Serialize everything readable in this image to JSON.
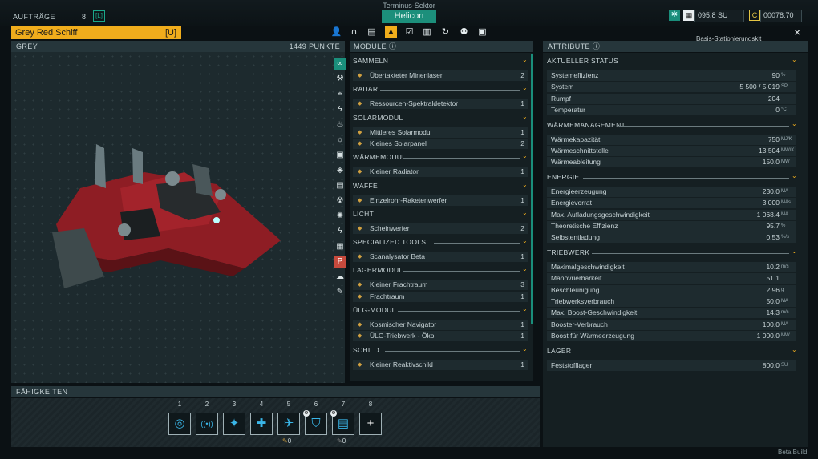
{
  "top": {
    "sector": "Terminus-Sektor",
    "location": "Helicon",
    "auftraege_label": "AUFTRÄGE",
    "auftraege_count": "8",
    "auftraege_key": "[L]",
    "res1": "095.8 SU",
    "res2": "00078.70"
  },
  "ship": {
    "name": "Grey Red Schiff",
    "key": "[U]",
    "faction": "GREY",
    "points": "1449 PUNKTE"
  },
  "tabs": [
    "person-icon",
    "network-icon",
    "storage-icon",
    "ship-icon",
    "checklist-icon",
    "map-icon",
    "history-icon",
    "crew-icon",
    "log-icon"
  ],
  "close": "×",
  "basis_label": "Basis-Stationierungskit",
  "modules": {
    "header": "MODULE",
    "sections": [
      {
        "name": "SAMMELN",
        "items": [
          {
            "n": "Übertakteter Minenlaser",
            "c": "2"
          }
        ]
      },
      {
        "name": "RADAR",
        "items": [
          {
            "n": "Ressourcen-Spektraldetektor",
            "c": "1"
          }
        ]
      },
      {
        "name": "SOLARMODUL",
        "items": [
          {
            "n": "Mittleres Solarmodul",
            "c": "1"
          },
          {
            "n": "Kleines Solarpanel",
            "c": "2"
          }
        ]
      },
      {
        "name": "WÄRMEMODUL",
        "items": [
          {
            "n": "Kleiner Radiator",
            "c": "1"
          }
        ]
      },
      {
        "name": "WAFFE",
        "items": [
          {
            "n": "Einzelrohr-Raketenwerfer",
            "c": "1"
          }
        ]
      },
      {
        "name": "LICHT",
        "items": [
          {
            "n": "Scheinwerfer",
            "c": "2"
          }
        ]
      },
      {
        "name": "SPECIALIZED TOOLS",
        "items": [
          {
            "n": "Scanalysator Beta",
            "c": "1"
          }
        ]
      },
      {
        "name": "LAGERMODUL",
        "items": [
          {
            "n": "Kleiner Frachtraum",
            "c": "3"
          },
          {
            "n": "Frachtraum",
            "c": "1"
          }
        ]
      },
      {
        "name": "ÜLG-MODUL",
        "items": [
          {
            "n": "Kosmischer Navigator",
            "c": "1"
          },
          {
            "n": "ÜLG-Triebwerk - Öko",
            "c": "1"
          }
        ]
      },
      {
        "name": "SCHILD",
        "items": [
          {
            "n": "Kleiner Reaktivschild",
            "c": "1"
          }
        ]
      }
    ]
  },
  "attributes": {
    "header": "ATTRIBUTE",
    "sections": [
      {
        "name": "AKTUELLER STATUS",
        "rows": [
          {
            "n": "Systemeffizienz",
            "v": "90",
            "u": "%"
          },
          {
            "n": "System",
            "v": "5 500 / 5 019",
            "u": "SP"
          },
          {
            "n": "Rumpf",
            "v": "204",
            "u": ""
          },
          {
            "n": "Temperatur",
            "v": "0",
            "u": "°C"
          }
        ]
      },
      {
        "name": "WÄRMEMANAGEMENT",
        "rows": [
          {
            "n": "Wärmekapazität",
            "v": "750",
            "u": "MJ/K"
          },
          {
            "n": "Wärmeschnittstelle",
            "v": "13 504",
            "u": "MW/K"
          },
          {
            "n": "Wärmeableitung",
            "v": "150.0",
            "u": "MW"
          }
        ]
      },
      {
        "name": "ENERGIE",
        "rows": [
          {
            "n": "Energieerzeugung",
            "v": "230.0",
            "u": "MA"
          },
          {
            "n": "Energievorrat",
            "v": "3 000",
            "u": "MAs"
          },
          {
            "n": "Max. Aufladungsgeschwindigkeit",
            "v": "1 068.4",
            "u": "MA"
          },
          {
            "n": "Theoretische Effizienz",
            "v": "95.7",
            "u": "%"
          },
          {
            "n": "Selbstentladung",
            "v": "0.53",
            "u": "%/s"
          }
        ]
      },
      {
        "name": "TRIEBWERK",
        "rows": [
          {
            "n": "Maximalgeschwindigkeit",
            "v": "10.2",
            "u": "m/s"
          },
          {
            "n": "Manövrierbarkeit",
            "v": "51.1",
            "u": ""
          },
          {
            "n": "Beschleunigung",
            "v": "2.96",
            "u": "g"
          },
          {
            "n": "Triebwerksverbrauch",
            "v": "50.0",
            "u": "MA"
          },
          {
            "n": "Max. Boost-Geschwindigkeit",
            "v": "14.3",
            "u": "m/s"
          },
          {
            "n": "Booster-Verbrauch",
            "v": "100.0",
            "u": "MA"
          },
          {
            "n": "Boost für Wärmeerzeugung",
            "v": "1 000.0",
            "u": "MW"
          }
        ]
      },
      {
        "name": "LAGER",
        "rows": [
          {
            "n": "Feststofflager",
            "v": "800.0",
            "u": "SU"
          }
        ]
      }
    ]
  },
  "abilities": {
    "header": "FÄHIGKEITEN",
    "slots": [
      "1",
      "2",
      "3",
      "4",
      "5",
      "6",
      "7",
      "8"
    ],
    "count1": "0",
    "count2": "0"
  },
  "beta": "Beta Build"
}
